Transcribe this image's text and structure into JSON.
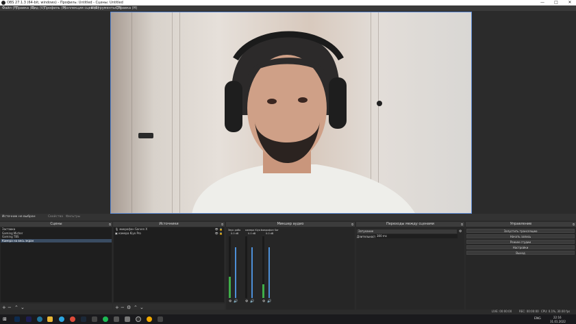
{
  "window": {
    "title": "OBS 27.1.3 (64-bit, windows) - Профиль: Untitled - Сцены: Untitled",
    "minimize": "—",
    "maximize": "□",
    "close": "✕"
  },
  "menu": [
    "Файл (F)",
    "Правка (E)",
    "Вид (V)",
    "Профиль (P)",
    "Коллекция сцен (S)",
    "Инструменты (T)",
    "Справка (H)"
  ],
  "source_bar": {
    "label": "Источник не выбран",
    "properties": "Свойства",
    "filters": "Фильтры"
  },
  "scenes": {
    "title": "Сцены",
    "items": [
      "Заставка",
      "Gaming Micher",
      "Gaming TBS",
      "Камера на весь экран"
    ],
    "selected": 3
  },
  "sources": {
    "title": "Источники",
    "items": [
      "микрофон Sarven X",
      "камера Kiyo Pro"
    ]
  },
  "mixer": {
    "title": "Микшер аудио",
    "channels": [
      {
        "name": "Звук рабо",
        "db": "0.0 dB",
        "level": 0.35,
        "fader": 0.82
      },
      {
        "name": "камера Kiyo Pro",
        "db": "0.0 dB",
        "level": 0.0,
        "fader": 0.82
      },
      {
        "name": "микрофон Sarven X",
        "db": "0.0 dB",
        "level": 0.22,
        "fader": 0.82
      }
    ]
  },
  "transitions": {
    "title": "Переходы между сценами",
    "type": "Затухание",
    "duration_label": "Длительность",
    "duration": "300 ms"
  },
  "controls": {
    "title": "Управление",
    "buttons": [
      "Запустить трансляцию",
      "Начать запись",
      "Режим студии",
      "Настройки",
      "Выход"
    ]
  },
  "status": {
    "live": "LIVE: 00:00:00",
    "rec": "REC: 00:00:00",
    "cpu": "CPU: 0.1%, 30.00 fps"
  },
  "tray": {
    "lang": "ENG",
    "time": "22:16",
    "date": "31.01.2022"
  },
  "colors": {
    "accent": "#5d8bd6",
    "meter_green": "#3fae49",
    "fader": "#4d90d9"
  }
}
